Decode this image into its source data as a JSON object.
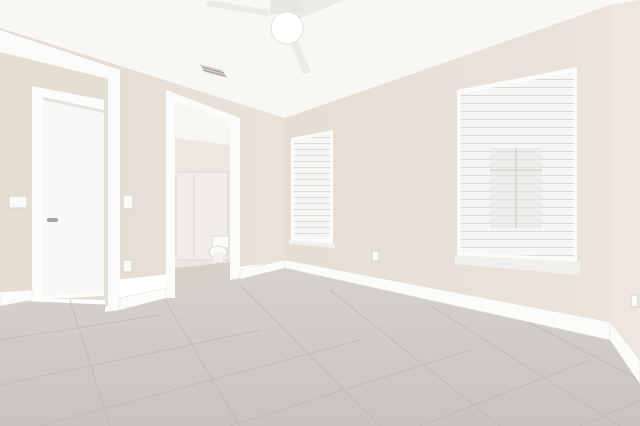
{
  "scene": {
    "description_free": true,
    "colors": {
      "ceiling": "#f7f6f3",
      "wall_left": "#e8dfd6",
      "wall_back": "#e9e2da",
      "wall_right": "#ece6df",
      "floor": "#cfccc7",
      "floor_grout": "#bdb9b3",
      "trim": "#ffffff",
      "door": "#f8f8f6",
      "blind": "#f5f5f3",
      "bath_wall": "#eeeae4"
    }
  }
}
